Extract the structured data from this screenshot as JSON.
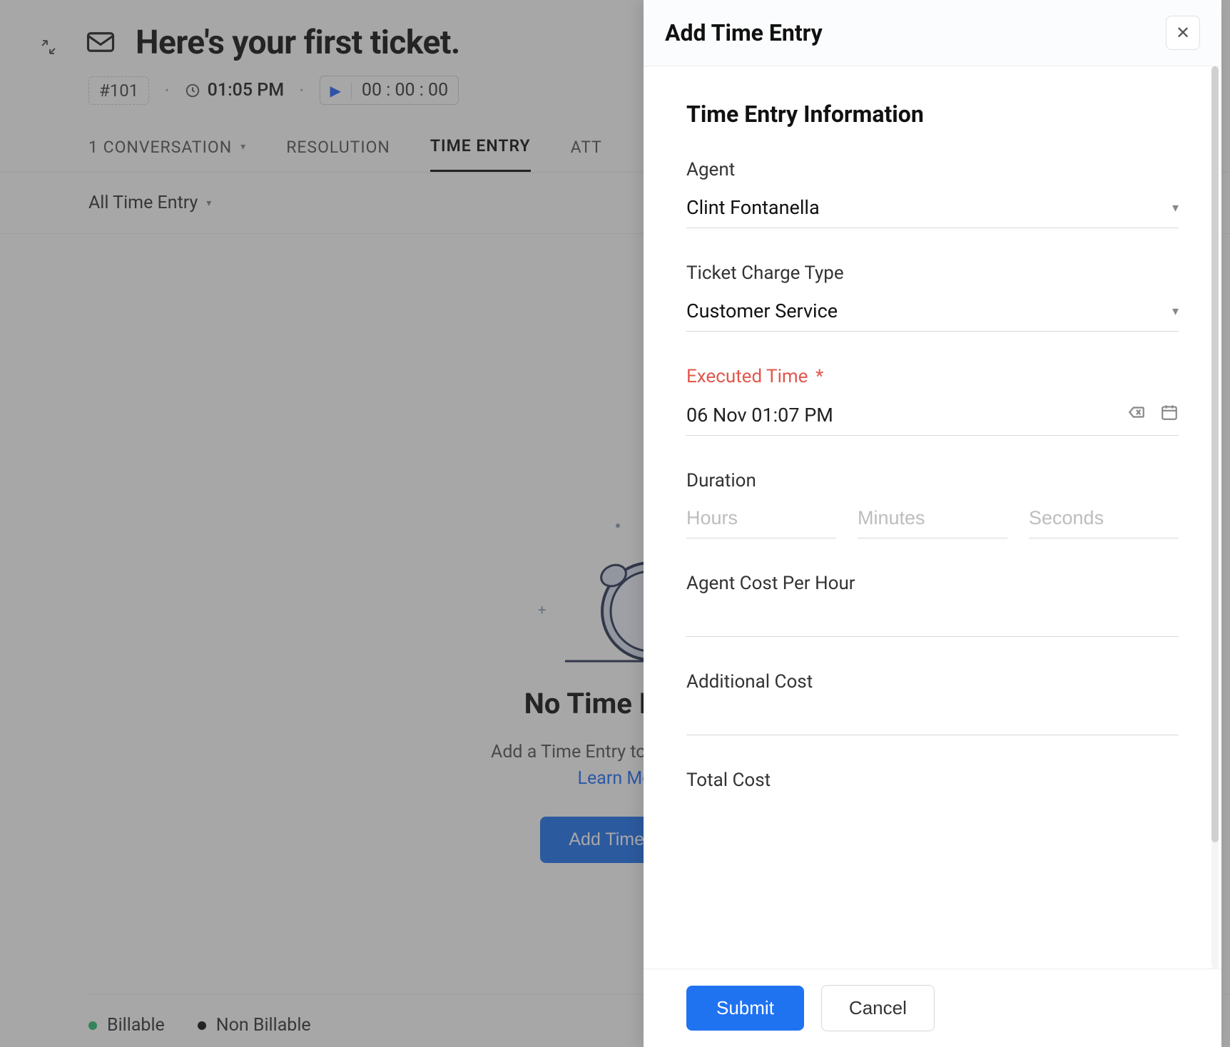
{
  "ticket": {
    "title": "Here's your first ticket.",
    "id": "#101",
    "clock_time": "01:05 PM",
    "timer": "00 : 00 : 00"
  },
  "tabs": {
    "conversation": "1 CONVERSATION",
    "resolution": "RESOLUTION",
    "time_entry": "TIME ENTRY",
    "attachments": "ATT"
  },
  "filter": {
    "label": "All Time Entry"
  },
  "empty": {
    "title": "No Time Entry",
    "subtitle": "Add a Time Entry to track your t",
    "learn_more": "Learn Mo",
    "add_button": "Add Time E"
  },
  "legend": {
    "billable": "Billable",
    "non_billable": "Non Billable"
  },
  "panel": {
    "header": "Add Time Entry",
    "section_title": "Time Entry Information",
    "agent_label": "Agent",
    "agent_value": "Clint Fontanella",
    "charge_label": "Ticket Charge Type",
    "charge_value": "Customer Service",
    "executed_label": "Executed Time",
    "executed_star": "*",
    "executed_value": "06 Nov 01:07 PM",
    "duration_label": "Duration",
    "hours_ph": "Hours",
    "minutes_ph": "Minutes",
    "seconds_ph": "Seconds",
    "agent_cost_label": "Agent Cost Per Hour",
    "additional_cost_label": "Additional Cost",
    "total_cost_label": "Total Cost",
    "submit": "Submit",
    "cancel": "Cancel"
  }
}
